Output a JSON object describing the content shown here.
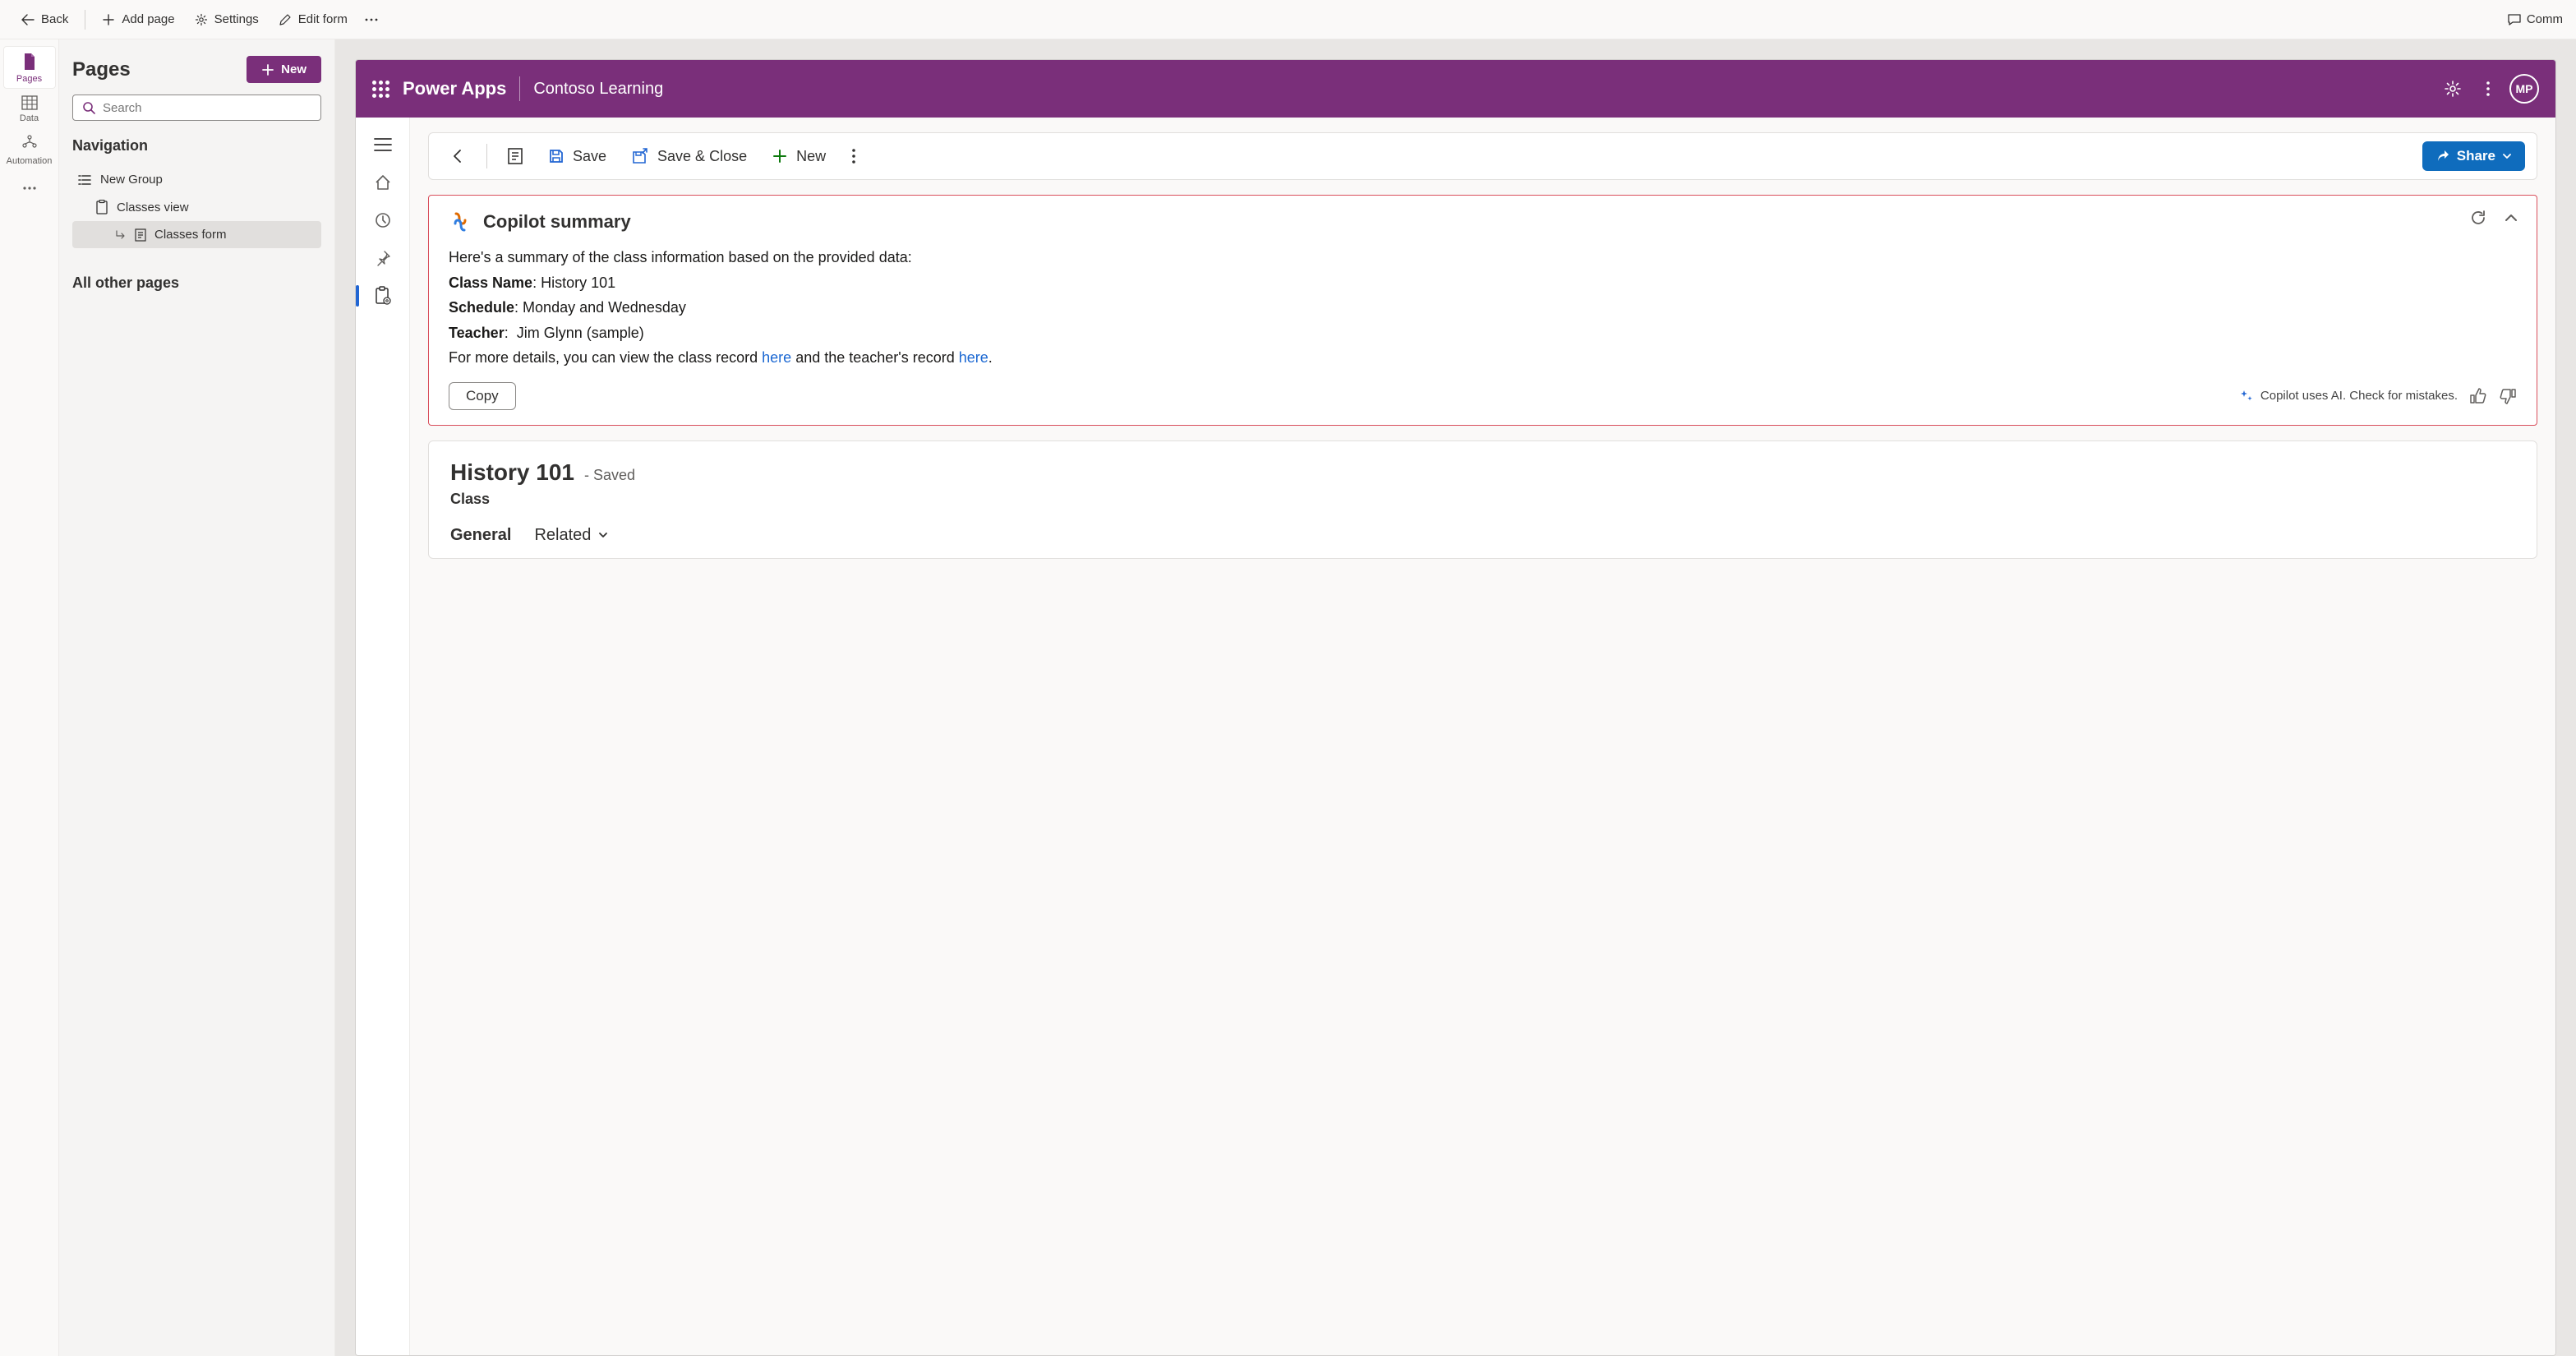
{
  "topbar": {
    "back": "Back",
    "add_page": "Add page",
    "settings": "Settings",
    "edit_form": "Edit form",
    "comments": "Comm"
  },
  "left_rail": {
    "pages": "Pages",
    "data": "Data",
    "automation": "Automation"
  },
  "pages_panel": {
    "title": "Pages",
    "new_button": "New",
    "search_placeholder": "Search",
    "navigation_title": "Navigation",
    "groups": [
      {
        "label": "New Group"
      }
    ],
    "items": [
      {
        "label": "Classes view",
        "selected": false
      },
      {
        "label": "Classes form",
        "selected": true
      }
    ],
    "all_other": "All other pages"
  },
  "preview_header": {
    "app_name": "Power Apps",
    "env_name": "Contoso Learning",
    "avatar_initials": "MP"
  },
  "record_bar": {
    "save": "Save",
    "save_close": "Save & Close",
    "new": "New",
    "share": "Share"
  },
  "copilot": {
    "title": "Copilot summary",
    "intro": "Here's a summary of the class information based on the provided data:",
    "fields": {
      "class_name_label": "Class Name",
      "class_name_value": "History 101",
      "schedule_label": "Schedule",
      "schedule_value": "Monday and Wednesday",
      "teacher_label": "Teacher",
      "teacher_value": "Jim Glynn (sample)"
    },
    "more_prefix": "For more details, you can view the class record ",
    "more_link1": "here",
    "more_middle": " and the teacher's record ",
    "more_link2": "here",
    "more_suffix": ".",
    "copy": "Copy",
    "ai_note": "Copilot uses AI. Check for mistakes."
  },
  "record": {
    "title": "History 101",
    "saved_suffix": "- Saved",
    "entity": "Class",
    "tabs": {
      "general": "General",
      "related": "Related"
    }
  }
}
